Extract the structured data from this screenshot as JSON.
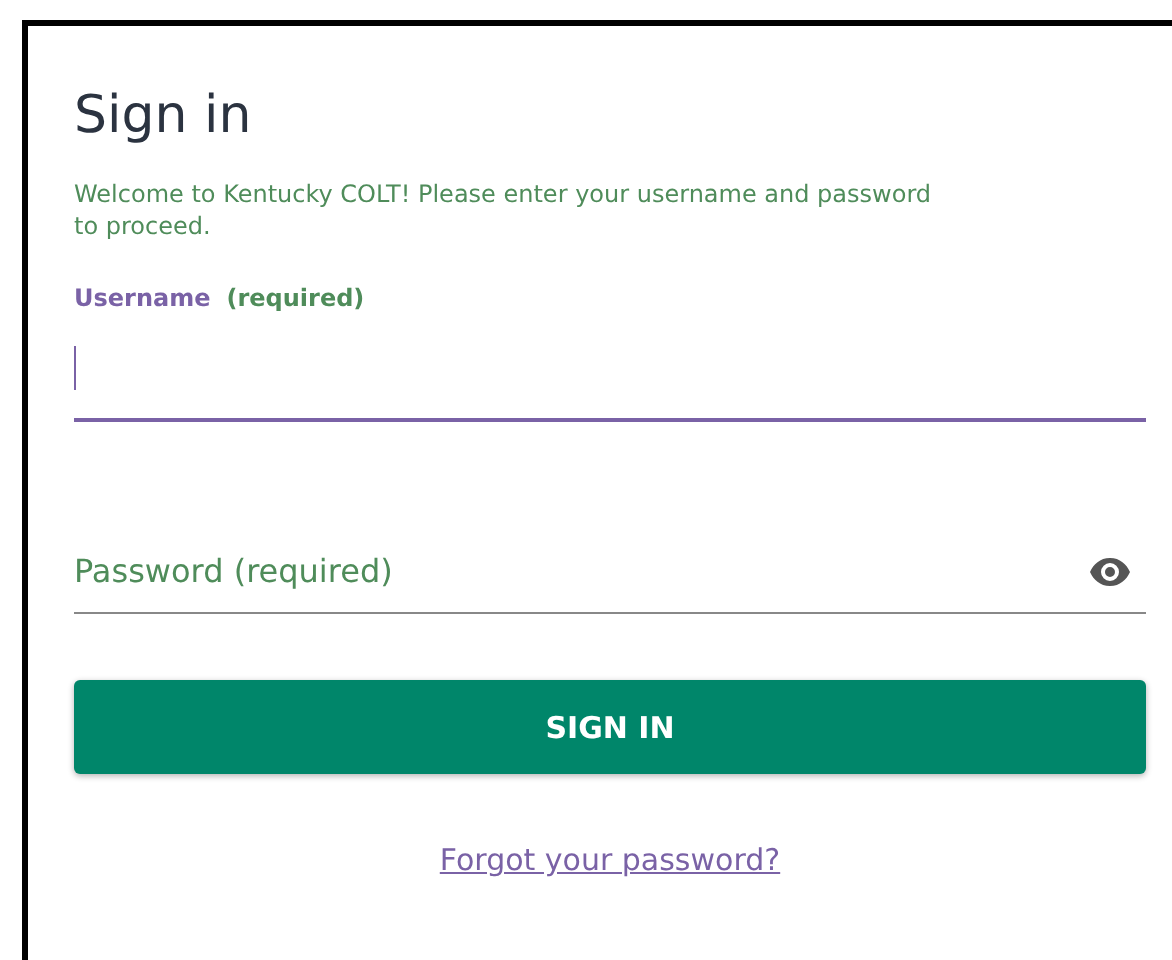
{
  "title": "Sign in",
  "intro": "Welcome to Kentucky COLT! Please enter your username and password to proceed.",
  "username": {
    "label": "Username",
    "note": "(required)",
    "focused": true
  },
  "password": {
    "placeholder": "Password (required)"
  },
  "button": "SIGN IN",
  "link": "Forgot your password?"
}
